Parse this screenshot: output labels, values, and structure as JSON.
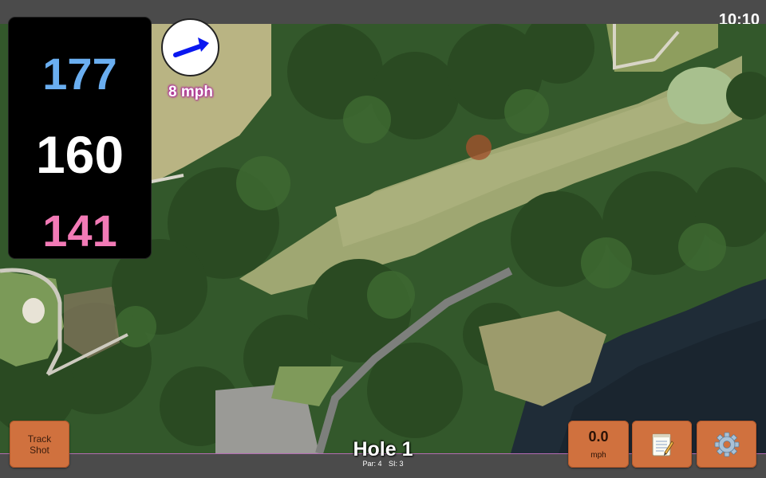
{
  "status_bar": {
    "time": "10:10"
  },
  "distances": {
    "back": "177",
    "middle": "160",
    "front": "141",
    "colors": {
      "back": "#6aaef0",
      "middle": "#ffffff",
      "front": "#f27ab6"
    }
  },
  "wind": {
    "speed_label": "8 mph",
    "direction_icon": "arrow-right-up-icon",
    "arrow_color": "#0a18f0"
  },
  "buttons": {
    "track_shot_line1": "Track",
    "track_shot_line2": "Shot",
    "speed_value": "0.0",
    "speed_unit": "mph",
    "notes_icon": "notepad-icon",
    "settings_icon": "gear-icon",
    "accent": "#d0713e"
  },
  "hole": {
    "title": "Hole 1",
    "par": "Par: 4",
    "stroke_index": "SI: 3"
  },
  "map": {
    "type": "satellite-aerial-course-view"
  }
}
